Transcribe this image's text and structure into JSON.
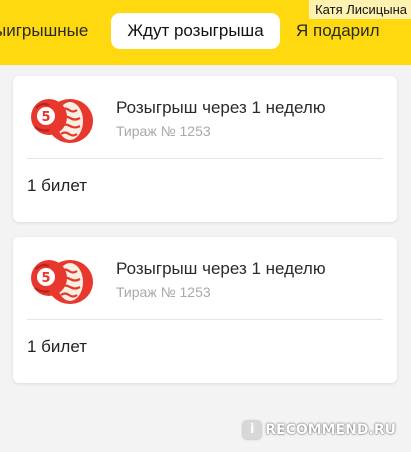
{
  "tabs": [
    {
      "label": "ыигрышные"
    },
    {
      "label": "Ждут розыгрыша",
      "active": true
    },
    {
      "label": "Я подарил"
    }
  ],
  "user_label": "Катя Лисицына",
  "cards": [
    {
      "title": "Розыгрыш через 1 неделю",
      "draw": "Тираж № 1253",
      "tickets": "1 билет",
      "ball_number": "5"
    },
    {
      "title": "Розыгрыш через 1 неделю",
      "draw": "Тираж № 1253",
      "tickets": "1 билет",
      "ball_number": "5"
    }
  ],
  "watermark": {
    "mark": "i",
    "text": "RECOMMEND.RU"
  },
  "colors": {
    "accent_yellow": "#ffd90f",
    "ball_red": "#e8372c",
    "background": "#f3f3f3"
  }
}
